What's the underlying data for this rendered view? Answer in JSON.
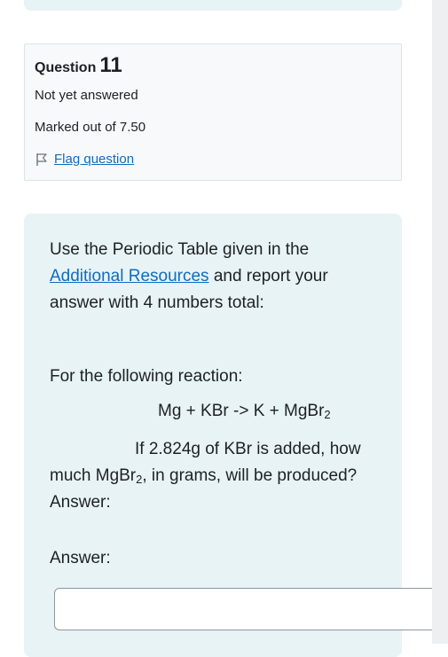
{
  "info": {
    "question_label": "Question",
    "question_number": "11",
    "state": "Not yet answered",
    "grade": "Marked out of 7.50",
    "flag_label": "Flag question",
    "flag_icon": "flag-icon"
  },
  "question": {
    "intro_before": "Use the Periodic Table given in the ",
    "intro_link": "Additional Resources",
    "intro_after": " and report your answer with 4 numbers total:",
    "reaction_label": "For the following reaction:",
    "equation_main": "Mg + KBr -> K + MgBr",
    "equation_sub": "2",
    "prompt_part1": "If 2.824g of KBr is added, how much MgBr",
    "prompt_sub": "2",
    "prompt_part2": ", in grams, will be produced? Answer:",
    "answer_label": "Answer:"
  },
  "answer": {
    "value": "",
    "placeholder": ""
  },
  "colors": {
    "card_background": "#e7f3f5",
    "info_background": "#f8f9fa",
    "link": "#0f6cbf",
    "text": "#1d2125"
  }
}
